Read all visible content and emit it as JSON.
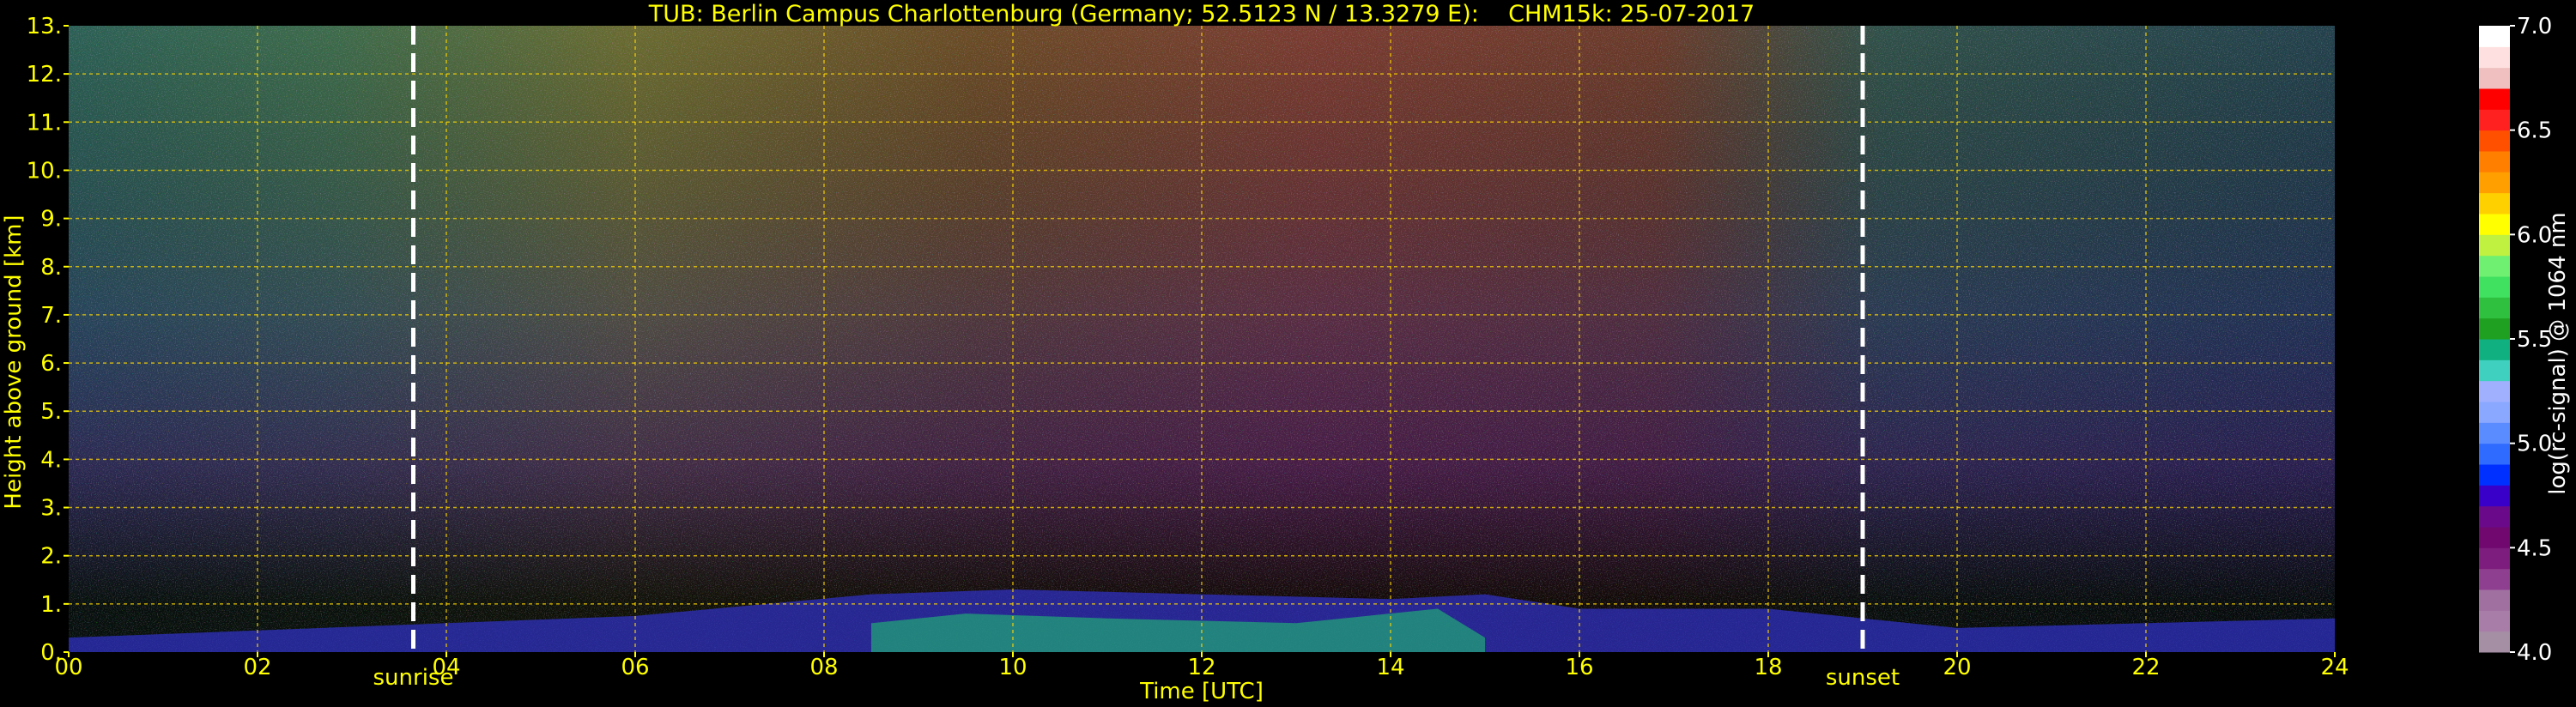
{
  "chart_data": {
    "type": "heatmap",
    "title": "TUB: Berlin Campus Charlottenburg (Germany; 52.5123 N / 13.3279 E):    CHM15k: 25-07-2017",
    "xlabel": "Time [UTC]",
    "ylabel": "Height above ground [km]",
    "xlim": [
      0,
      24
    ],
    "ylim": [
      0,
      13
    ],
    "x_ticks": [
      "00",
      "02",
      "04",
      "06",
      "08",
      "10",
      "12",
      "14",
      "16",
      "18",
      "20",
      "22",
      "24"
    ],
    "y_ticks": [
      "0.",
      "1.",
      "2.",
      "3.",
      "4.",
      "5.",
      "6.",
      "7.",
      "8.",
      "9.",
      "10.",
      "11.",
      "12.",
      "13."
    ],
    "grid": true,
    "annotations": [
      {
        "label": "sunrise",
        "x": 3.65
      },
      {
        "label": "sunset",
        "x": 19.0
      }
    ],
    "colorbar": {
      "label": "log(rc-signal) @ 1064 nm",
      "range": [
        4.0,
        7.0
      ],
      "ticks": [
        "4.0",
        "4.5",
        "5.0",
        "5.5",
        "6.0",
        "6.5",
        "7.0"
      ],
      "colors": [
        "#a58fa5",
        "#a87ea8",
        "#a070a0",
        "#8f3f8f",
        "#7d1d7d",
        "#700870",
        "#6a0a8a",
        "#3800c8",
        "#0030ff",
        "#2f6bff",
        "#5a8cff",
        "#8aa8ff",
        "#a0b0ff",
        "#40d0c0",
        "#10b080",
        "#20a020",
        "#30c040",
        "#40e060",
        "#70f070",
        "#c0f040",
        "#ffff00",
        "#ffd000",
        "#ffa000",
        "#ff8000",
        "#ff5000",
        "#ff2020",
        "#ff0000",
        "#f0c0c0",
        "#ffe0e0",
        "#ffffff"
      ]
    },
    "colors": {
      "axis_text": "#ffff00",
      "grid": "#ffd700",
      "background": "#000000"
    }
  }
}
